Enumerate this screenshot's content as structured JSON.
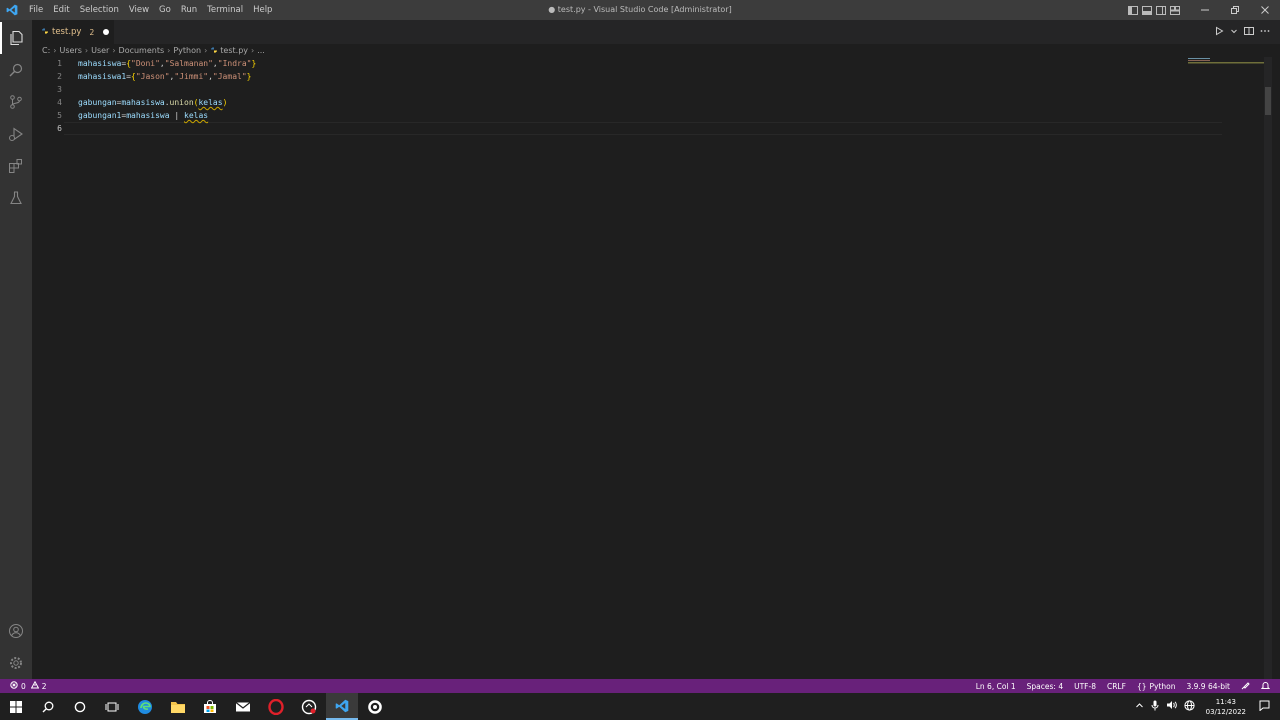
{
  "window": {
    "title": "● test.py - Visual Studio Code [Administrator]",
    "menu": [
      "File",
      "Edit",
      "Selection",
      "View",
      "Go",
      "Run",
      "Terminal",
      "Help"
    ]
  },
  "tab": {
    "label": "test.py",
    "problem_count": "2"
  },
  "breadcrumb": [
    "C:",
    "Users",
    "User",
    "Documents",
    "Python",
    "test.py",
    "..."
  ],
  "code": {
    "line_numbers": [
      "1",
      "2",
      "3",
      "4",
      "5",
      "6"
    ],
    "line1": {
      "var": "mahasiswa",
      "op": "=",
      "open": "{",
      "s1": "\"Doni\"",
      "s2": "\"Salmanan\"",
      "s3": "\"Indra\"",
      "comma": ",",
      "close": "}"
    },
    "line2": {
      "var": "mahasiswa1",
      "op": "=",
      "open": "{",
      "s1": "\"Jason\"",
      "s2": "\"Jimmi\"",
      "s3": "\"Jamal\"",
      "comma": ",",
      "close": "}"
    },
    "line4": {
      "var": "gabungan",
      "op": "=",
      "obj": "mahasiswa",
      "dot": ".",
      "fn": "union",
      "lp": "(",
      "arg": "kelas",
      "rp": ")"
    },
    "line5": {
      "var": "gabungan1",
      "op": "=",
      "obj": "mahasiswa",
      "pipe": " | ",
      "arg": "kelas"
    }
  },
  "status": {
    "errors": "0",
    "warnings": "2",
    "position": "Ln 6, Col 1",
    "spaces": "Spaces: 4",
    "encoding": "UTF-8",
    "eol": "CRLF",
    "language": "Python",
    "interpreter": "3.9.9 64-bit"
  },
  "taskbar": {
    "time": "11:43",
    "date": "03/12/2022"
  },
  "colors": {
    "statusbar": "#68217a",
    "titlebar": "#3c3c3c",
    "editor": "#1e1e1e",
    "accent": "#007acc"
  }
}
